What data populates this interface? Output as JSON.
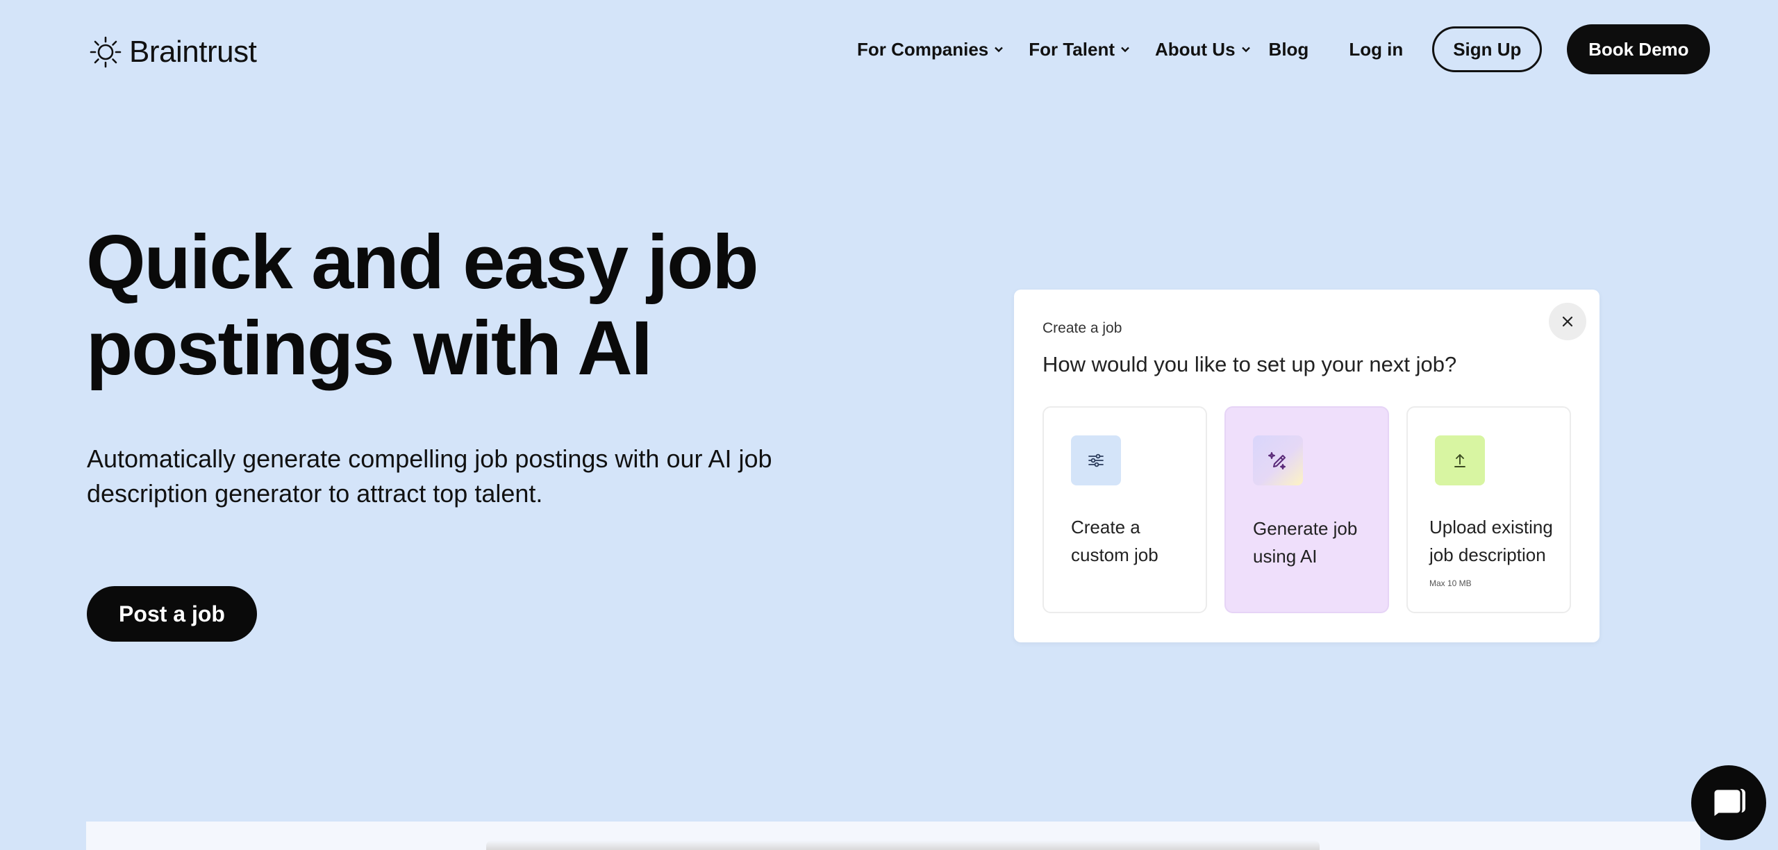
{
  "brand": {
    "name": "Braintrust"
  },
  "nav": {
    "items": [
      {
        "label": "For Companies",
        "dropdown": true
      },
      {
        "label": "For Talent",
        "dropdown": true
      },
      {
        "label": "About Us",
        "dropdown": true
      },
      {
        "label": "Blog",
        "dropdown": false
      },
      {
        "label": "Log in",
        "dropdown": false
      }
    ],
    "signup_label": "Sign Up",
    "demo_label": "Book Demo"
  },
  "hero": {
    "title_line1": "Quick and easy job",
    "title_line2": "postings with AI",
    "subtitle_line1": "Automatically generate compelling job postings with our AI job",
    "subtitle_line2": "description generator to attract top talent.",
    "cta_label": "Post a job"
  },
  "modal": {
    "kicker": "Create a job",
    "title": "How would you like to set up your next job?",
    "options": [
      {
        "label_line1": "Create a",
        "label_line2": "custom job",
        "icon": "sliders-icon"
      },
      {
        "label_line1": "Generate job",
        "label_line2": "using AI",
        "icon": "magic-pen-icon"
      },
      {
        "label_line1": "Upload existing",
        "label_line2": "job description",
        "note": "Max 10 MB",
        "icon": "upload-icon"
      }
    ]
  },
  "colors": {
    "background": "#d4e4f9",
    "dark": "#0a0a0a",
    "ai_option": "#efdffb",
    "upload_icon_bg": "#d8f5a2"
  }
}
